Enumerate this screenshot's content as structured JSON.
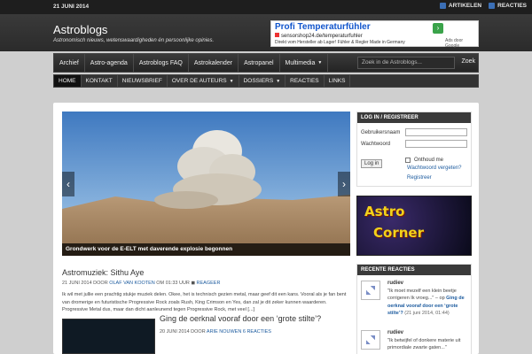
{
  "topbar": {
    "date": "21 JUNI 2014",
    "feeds": [
      {
        "label": "ARTIKELEN"
      },
      {
        "label": "REACTIES"
      }
    ]
  },
  "site": {
    "title": "Astroblogs",
    "description": "Astronomisch nieuws, wetenswaardigheden én persoonlijke opinies."
  },
  "ad": {
    "title": "Profi Temperaturfühler",
    "url": "sensorshop24.de/temperaturfuhler",
    "desc": "Direkt vom Hersteller ab Lager! Fühler & Regler Made in Germany",
    "adsby": "Ads door Google"
  },
  "mainnav": {
    "items": [
      {
        "label": "Archief"
      },
      {
        "label": "Astro-agenda"
      },
      {
        "label": "Astroblogs FAQ"
      },
      {
        "label": "Astrokalender"
      },
      {
        "label": "Astropanel"
      },
      {
        "label": "Multimedia"
      }
    ],
    "search_placeholder": "Zoek in de Astroblogs...",
    "search_button": "Zoek"
  },
  "subnav": {
    "items": [
      {
        "label": "HOME"
      },
      {
        "label": "KONTAKT"
      },
      {
        "label": "NIEUWSBRIEF"
      },
      {
        "label": "OVER DE AUTEURS"
      },
      {
        "label": "DOSSIERS"
      },
      {
        "label": "REACTIES"
      },
      {
        "label": "LINKS"
      }
    ]
  },
  "slider": {
    "caption": "Grondwerk voor de E-ELT met daverende explosie begonnen"
  },
  "post1": {
    "title": "Astromuziek: Sithu Aye",
    "date": "21 JUNI 2014",
    "door": "DOOR",
    "author": "OLAF VAN KOOTEN",
    "om": "OM",
    "time": "01:33 UUR",
    "comment_link": "REAGEER",
    "excerpt": "Ik wil met jullie een prachtig stukje muziek delen. Okee, het is technisch gezien metal, maar geef dit een kans. Vooral als je fan bent van dromerige en futuristische Progressive Rock zoals Rush, King Crimson en Yes, dan zal je dit zeker kunnen waarderen. Progressive Metal dus, maar dan dicht aanleunend tegen Progressive Rock, met veel [...]"
  },
  "post2": {
    "title": "Ging de oerknal vooraf door een ‘grote stilte’?",
    "date": "20 JUNI 2014",
    "door": "DOOR",
    "author": "ARIE NOUWEN",
    "reactions": "6 REACTIES"
  },
  "login": {
    "title": "LOG IN / REGISTREER",
    "username_label": "Gebruikersnaam",
    "password_label": "Wachtwoord",
    "button": "Log in",
    "remember": "Onthoud me",
    "forgot": "Wachtwoord vergeten?",
    "register": "Registreer"
  },
  "banner": {
    "line1": "Astro",
    "line2": "Corner"
  },
  "recent_comments": {
    "title": "RECENTE REACTIES",
    "items": [
      {
        "name": "rudiev",
        "text_start": "\"Ik moet mezelf een klein beetje corrigeren    Ik vroeg...\" – op",
        "link": "Ging de oerknal vooraf door een ‘grote stilte’?",
        "date": "(21 juni 2014, 01:44)"
      },
      {
        "name": "rudiev",
        "text_start": "\"Ik betwijfel of donkere materie uit primordiale zwarte gaten...\""
      }
    ]
  }
}
